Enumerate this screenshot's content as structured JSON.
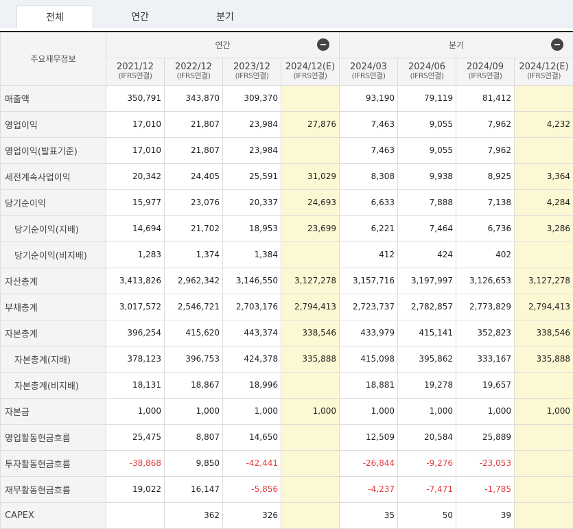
{
  "tabs": [
    "전체",
    "연간",
    "분기"
  ],
  "header": {
    "row_label": "주요재무정보",
    "annual_group": "연간",
    "quarter_group": "분기",
    "periods": [
      {
        "date": "2021/12",
        "sub": "(IFRS연결)"
      },
      {
        "date": "2022/12",
        "sub": "(IFRS연결)"
      },
      {
        "date": "2023/12",
        "sub": "(IFRS연결)"
      },
      {
        "date": "2024/12(E)",
        "sub": "(IFRS연결)"
      },
      {
        "date": "2024/03",
        "sub": "(IFRS연결)"
      },
      {
        "date": "2024/06",
        "sub": "(IFRS연결)"
      },
      {
        "date": "2024/09",
        "sub": "(IFRS연결)"
      },
      {
        "date": "2024/12(E)",
        "sub": "(IFRS연결)"
      }
    ]
  },
  "rows": [
    {
      "label": "매출액",
      "values": [
        "350,791",
        "343,870",
        "309,370",
        "",
        "93,190",
        "79,119",
        "81,412",
        ""
      ]
    },
    {
      "label": "영업이익",
      "values": [
        "17,010",
        "21,807",
        "23,984",
        "27,876",
        "7,463",
        "9,055",
        "7,962",
        "4,232"
      ]
    },
    {
      "label": "영업이익(발표기준)",
      "values": [
        "17,010",
        "21,807",
        "23,984",
        "",
        "7,463",
        "9,055",
        "7,962",
        ""
      ]
    },
    {
      "label": "세전계속사업이익",
      "values": [
        "20,342",
        "24,405",
        "25,591",
        "31,029",
        "8,308",
        "9,938",
        "8,925",
        "3,364"
      ]
    },
    {
      "label": "당기순이익",
      "values": [
        "15,977",
        "23,076",
        "20,337",
        "24,693",
        "6,633",
        "7,888",
        "7,138",
        "4,284"
      ]
    },
    {
      "label": "당기순이익(지배)",
      "values": [
        "14,694",
        "21,702",
        "18,953",
        "23,699",
        "6,221",
        "7,464",
        "6,736",
        "3,286"
      ]
    },
    {
      "label": "당기순이익(비지배)",
      "values": [
        "1,283",
        "1,374",
        "1,384",
        "",
        "412",
        "424",
        "402",
        ""
      ]
    },
    {
      "label": "자산총계",
      "values": [
        "3,413,826",
        "2,962,342",
        "3,146,550",
        "3,127,278",
        "3,157,716",
        "3,197,997",
        "3,126,653",
        "3,127,278"
      ]
    },
    {
      "label": "부채총계",
      "values": [
        "3,017,572",
        "2,546,721",
        "2,703,176",
        "2,794,413",
        "2,723,737",
        "2,782,857",
        "2,773,829",
        "2,794,413"
      ]
    },
    {
      "label": "자본총계",
      "values": [
        "396,254",
        "415,620",
        "443,374",
        "338,546",
        "433,979",
        "415,141",
        "352,823",
        "338,546"
      ]
    },
    {
      "label": "자본총계(지배)",
      "values": [
        "378,123",
        "396,753",
        "424,378",
        "335,888",
        "415,098",
        "395,862",
        "333,167",
        "335,888"
      ]
    },
    {
      "label": "자본총계(비지배)",
      "values": [
        "18,131",
        "18,867",
        "18,996",
        "",
        "18,881",
        "19,278",
        "19,657",
        ""
      ]
    },
    {
      "label": "자본금",
      "values": [
        "1,000",
        "1,000",
        "1,000",
        "1,000",
        "1,000",
        "1,000",
        "1,000",
        "1,000"
      ]
    },
    {
      "label": "영업활동현금흐름",
      "values": [
        "25,475",
        "8,807",
        "14,650",
        "",
        "12,509",
        "20,584",
        "25,889",
        ""
      ]
    },
    {
      "label": "투자활동현금흐름",
      "values": [
        "-38,868",
        "9,850",
        "-42,441",
        "",
        "-26,844",
        "-9,276",
        "-23,053",
        ""
      ]
    },
    {
      "label": "재무활동현금흐름",
      "values": [
        "19,022",
        "16,147",
        "-5,856",
        "",
        "-4,237",
        "-7,471",
        "-1,785",
        ""
      ]
    },
    {
      "label": "CAPEX",
      "values": [
        "",
        "362",
        "326",
        "",
        "35",
        "50",
        "39",
        ""
      ]
    }
  ],
  "colors": {
    "estimate_bg": "#fcf8d3",
    "negative": "#e23b3b",
    "header_bg": "#f4f4f4",
    "tabbar_bg": "#eef1f6"
  },
  "icons": {
    "collapse": "minus-circle-icon"
  }
}
